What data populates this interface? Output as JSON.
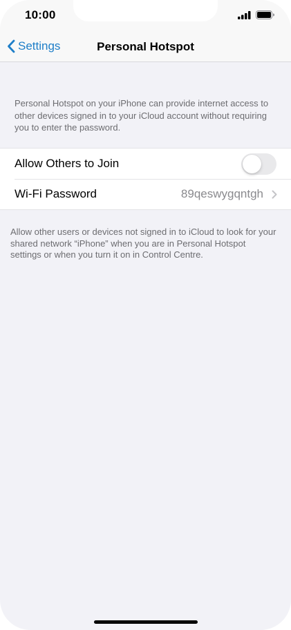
{
  "status_bar": {
    "time": "10:00",
    "signal_icon": "cellular-signal-icon",
    "battery_icon": "battery-icon"
  },
  "nav": {
    "back_label": "Settings",
    "back_icon": "chevron-left-icon",
    "title": "Personal Hotspot"
  },
  "intro_text": "Personal Hotspot on your iPhone can provide internet access to other devices signed in to your iCloud account without requiring you to enter the password.",
  "settings": {
    "allow_others": {
      "label": "Allow Others to Join",
      "enabled": false
    },
    "wifi_password": {
      "label": "Wi-Fi Password",
      "value": "89qeswygqntgh",
      "chevron_icon": "chevron-right-icon"
    }
  },
  "footer_text": "Allow other users or devices not signed in to iCloud to look for your shared network “iPhone” when you are in Personal Hotspot settings or when you turn it on in Control Centre.",
  "colors": {
    "accent": "#1e7ec8",
    "background": "#f2f2f7",
    "secondary_text": "#6c6c70",
    "toggle_off": "#e9e9eb"
  }
}
